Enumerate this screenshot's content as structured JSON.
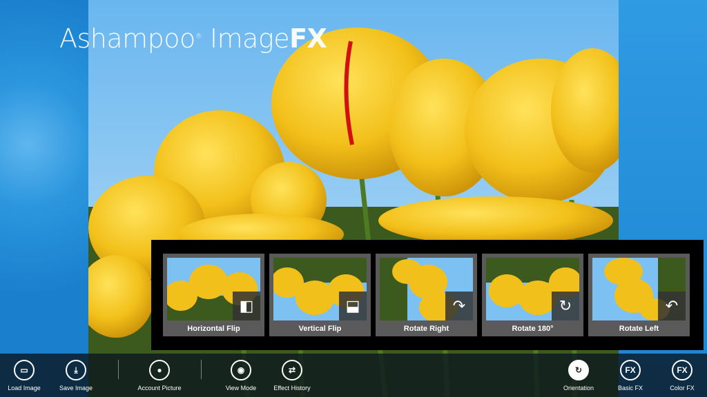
{
  "app": {
    "title_main": "Ashampoo",
    "title_reg": "®",
    "title_product": " Image",
    "title_fx": "FX"
  },
  "panel": {
    "tiles": [
      {
        "label": "Horizontal Flip",
        "icon": "horizontal-flip-icon"
      },
      {
        "label": "Vertical Flip",
        "icon": "vertical-flip-icon"
      },
      {
        "label": "Rotate Right",
        "icon": "rotate-right-icon"
      },
      {
        "label": "Rotate 180°",
        "icon": "rotate-180-icon"
      },
      {
        "label": "Rotate Left",
        "icon": "rotate-left-icon"
      }
    ]
  },
  "appbar": {
    "load": "Load Image",
    "save": "Save Image",
    "account": "Account Picture",
    "view": "View Mode",
    "history": "Effect History",
    "orientation": "Orientation",
    "basic_fx": "Basic FX",
    "color_fx": "Color FX",
    "fx_glyph": "FX"
  },
  "colors": {
    "accent_blue": "#1e8ad6",
    "tulip_yellow": "#f2c21a",
    "panel_bg": "#000000"
  }
}
